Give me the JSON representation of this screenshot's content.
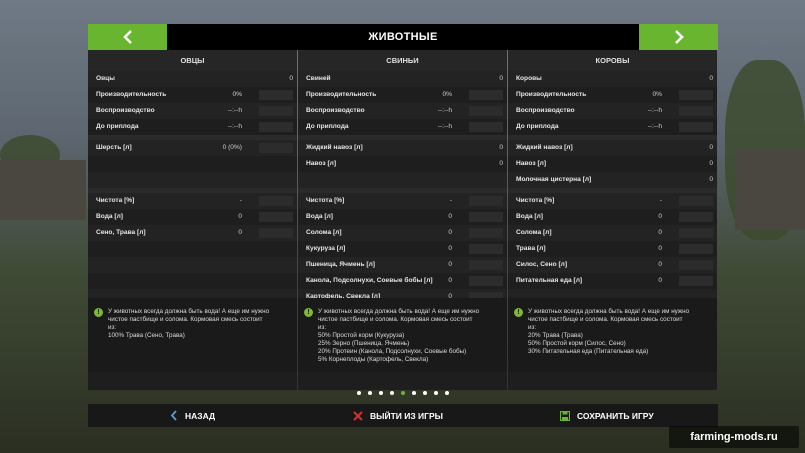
{
  "header": {
    "title": "ЖИВОТНЫЕ",
    "prev_icon": "chevron-left-icon",
    "next_icon": "chevron-right-icon"
  },
  "columns": [
    {
      "title": "ОВЦЫ",
      "stats": [
        {
          "label": "Овцы",
          "value": "0",
          "bar": false
        },
        {
          "label": "Производительность",
          "value": "0%",
          "bar": true
        },
        {
          "label": "Воспроизводство",
          "value": "--:--h",
          "bar": true
        },
        {
          "label": "До приплода",
          "value": "--:--h",
          "bar": true
        }
      ],
      "products": [
        {
          "label": "Шерсть [л]",
          "value": "0 (0%)",
          "bar": true
        }
      ],
      "feed": [
        {
          "label": "Чистота [%]",
          "value": "-",
          "bar": true
        },
        {
          "label": "Вода [л]",
          "value": "0",
          "bar": true
        },
        {
          "label": "Сено, Трава [л]",
          "value": "0",
          "bar": true
        }
      ],
      "info_lines": [
        "У животных всегда должна быть вода! А еще им нужно",
        "чистое пастбище и солома. Кормовая смесь состоит",
        "из:",
        "100% Трава (Сено, Трава)"
      ]
    },
    {
      "title": "СВИНЬИ",
      "stats": [
        {
          "label": "Свиней",
          "value": "0",
          "bar": false
        },
        {
          "label": "Производительность",
          "value": "0%",
          "bar": true
        },
        {
          "label": "Воспроизводство",
          "value": "--:--h",
          "bar": true
        },
        {
          "label": "До приплода",
          "value": "--:--h",
          "bar": true
        }
      ],
      "products": [
        {
          "label": "Жидкий навоз [л]",
          "value": "0",
          "bar": false
        },
        {
          "label": "Навоз [л]",
          "value": "0",
          "bar": false
        }
      ],
      "feed": [
        {
          "label": "Чистота [%]",
          "value": "-",
          "bar": true
        },
        {
          "label": "Вода [л]",
          "value": "0",
          "bar": true
        },
        {
          "label": "Солома [л]",
          "value": "0",
          "bar": true
        },
        {
          "label": "Кукуруза [л]",
          "value": "0",
          "bar": true
        },
        {
          "label": "Пшеница, Ячмень [л]",
          "value": "0",
          "bar": true
        },
        {
          "label": "Канола, Подсолнухи, Соевые бобы [л]",
          "value": "0",
          "bar": true
        },
        {
          "label": "Картофель, Свекла [л]",
          "value": "0",
          "bar": true
        }
      ],
      "info_lines": [
        "У животных всегда должна быть вода! А еще им нужно",
        "чистое пастбище и солома. Кормовая смесь состоит",
        "из:",
        "50% Простой корм (Кукуруза)",
        "25% Зерно (Пшеница, Ячмень)",
        "20% Протеин (Канола, Подсолнухи, Соевые бобы)",
        "5% Корнеплоды (Картофель, Свекла)"
      ]
    },
    {
      "title": "КОРОВЫ",
      "stats": [
        {
          "label": "Коровы",
          "value": "0",
          "bar": false
        },
        {
          "label": "Производительность",
          "value": "0%",
          "bar": true
        },
        {
          "label": "Воспроизводство",
          "value": "--:--h",
          "bar": true
        },
        {
          "label": "До приплода",
          "value": "--:--h",
          "bar": true
        }
      ],
      "products": [
        {
          "label": "Жидкий навоз [л]",
          "value": "0",
          "bar": false
        },
        {
          "label": "Навоз [л]",
          "value": "0",
          "bar": false
        },
        {
          "label": "Молочная цистерна [л]",
          "value": "0",
          "bar": false
        }
      ],
      "feed": [
        {
          "label": "Чистота [%]",
          "value": "-",
          "bar": true
        },
        {
          "label": "Вода [л]",
          "value": "0",
          "bar": true
        },
        {
          "label": "Солома [л]",
          "value": "0",
          "bar": true
        },
        {
          "label": "Трава [л]",
          "value": "0",
          "bar": true
        },
        {
          "label": "Силос, Сено [л]",
          "value": "0",
          "bar": true
        },
        {
          "label": "Питательная еда [л]",
          "value": "0",
          "bar": true
        }
      ],
      "info_lines": [
        "У животных всегда должна быть вода! А еще им нужно",
        "чистое пастбище и солома. Кормовая смесь состоит",
        "из:",
        "20% Трава (Трава)",
        "50% Простой корм (Силос, Сено)",
        "30% Питательная еда (Питательная еда)"
      ]
    }
  ],
  "pagination": {
    "pages": 9,
    "active_index": 4
  },
  "footer": {
    "back_label": "НАЗАД",
    "back_icon": "chevron-left-icon",
    "quit_label": "ВЫЙТИ ИЗ ИГРЫ",
    "quit_icon": "close-x-icon",
    "save_label": "СОХРАНИТЬ ИГРУ",
    "save_icon": "floppy-disk-icon"
  },
  "watermark": "farming-mods.ru",
  "colors": {
    "accent": "#69b52f",
    "quit_icon": "#d83030",
    "panel": "#1e1e1e"
  }
}
